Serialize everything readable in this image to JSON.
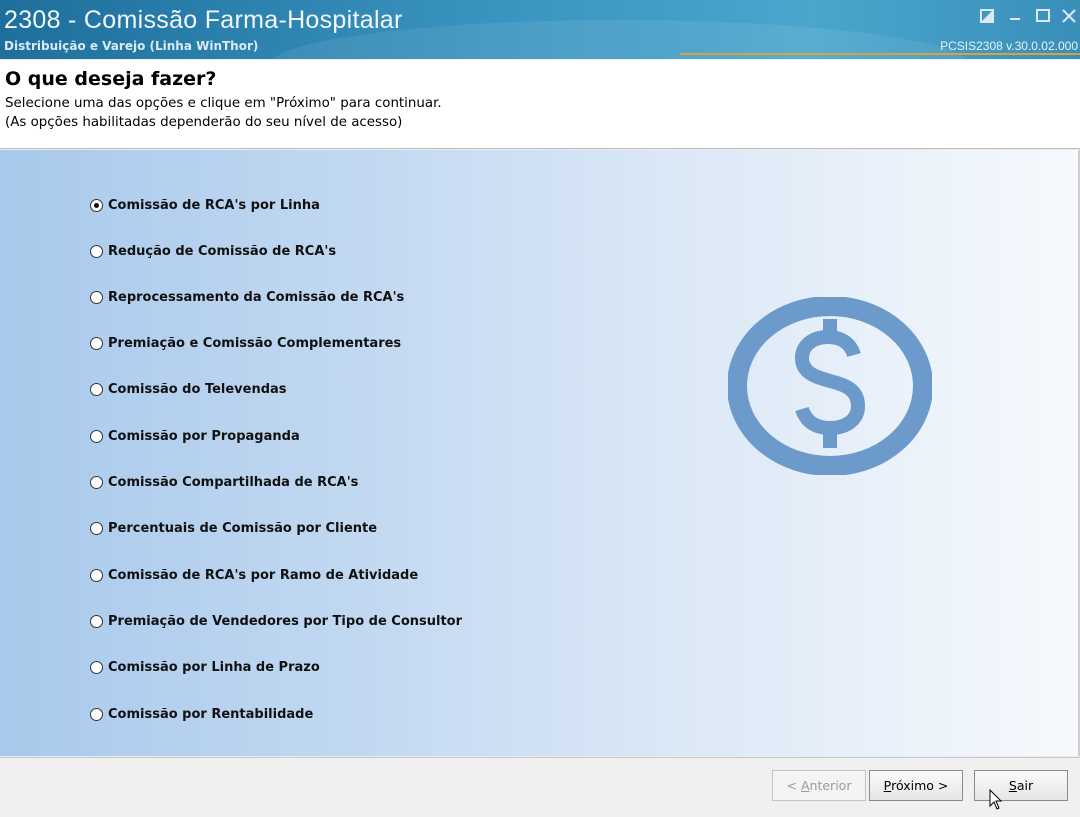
{
  "window": {
    "title": "2308 - Comissão Farma-Hospitalar",
    "subtitle": "Distribuição e Varejo (Linha WinThor)",
    "version": "PCSIS2308  v.30.0.02.000",
    "controls": [
      "restore-icon",
      "minimize-icon",
      "maximize-icon",
      "close-icon"
    ]
  },
  "header": {
    "heading": "O que deseja fazer?",
    "line1": "Selecione uma das opções e clique em \"Próximo\" para continuar.",
    "line2": "(As opções habilitadas dependerão do seu nível de acesso)"
  },
  "options": [
    {
      "label": "Comissão de RCA's por Linha",
      "selected": true
    },
    {
      "label": "Redução de Comissão de RCA's",
      "selected": false
    },
    {
      "label": "Reprocessamento da Comissão de RCA's",
      "selected": false
    },
    {
      "label": "Premiação e Comissão Complementares",
      "selected": false
    },
    {
      "label": "Comissão do Televendas",
      "selected": false
    },
    {
      "label": "Comissão por Propaganda",
      "selected": false
    },
    {
      "label": "Comissão Compartilhada de RCA's",
      "selected": false
    },
    {
      "label": "Percentuais de Comissão por Cliente",
      "selected": false
    },
    {
      "label": "Comissão de RCA's por Ramo de Atividade",
      "selected": false
    },
    {
      "label": "Premiação de Vendedores por Tipo de Consultor",
      "selected": false
    },
    {
      "label": "Comissão por Linha de Prazo",
      "selected": false
    },
    {
      "label": "Comissão por Rentabilidade",
      "selected": false
    }
  ],
  "illustration": {
    "icon": "dollar-coin-icon",
    "color": "#6b9acb"
  },
  "footer": {
    "back_prefix": "< ",
    "back_u": "A",
    "back_rest": "nterior",
    "next_u": "P",
    "next_rest": "róximo >",
    "exit_u": "S",
    "exit_rest": "air"
  }
}
